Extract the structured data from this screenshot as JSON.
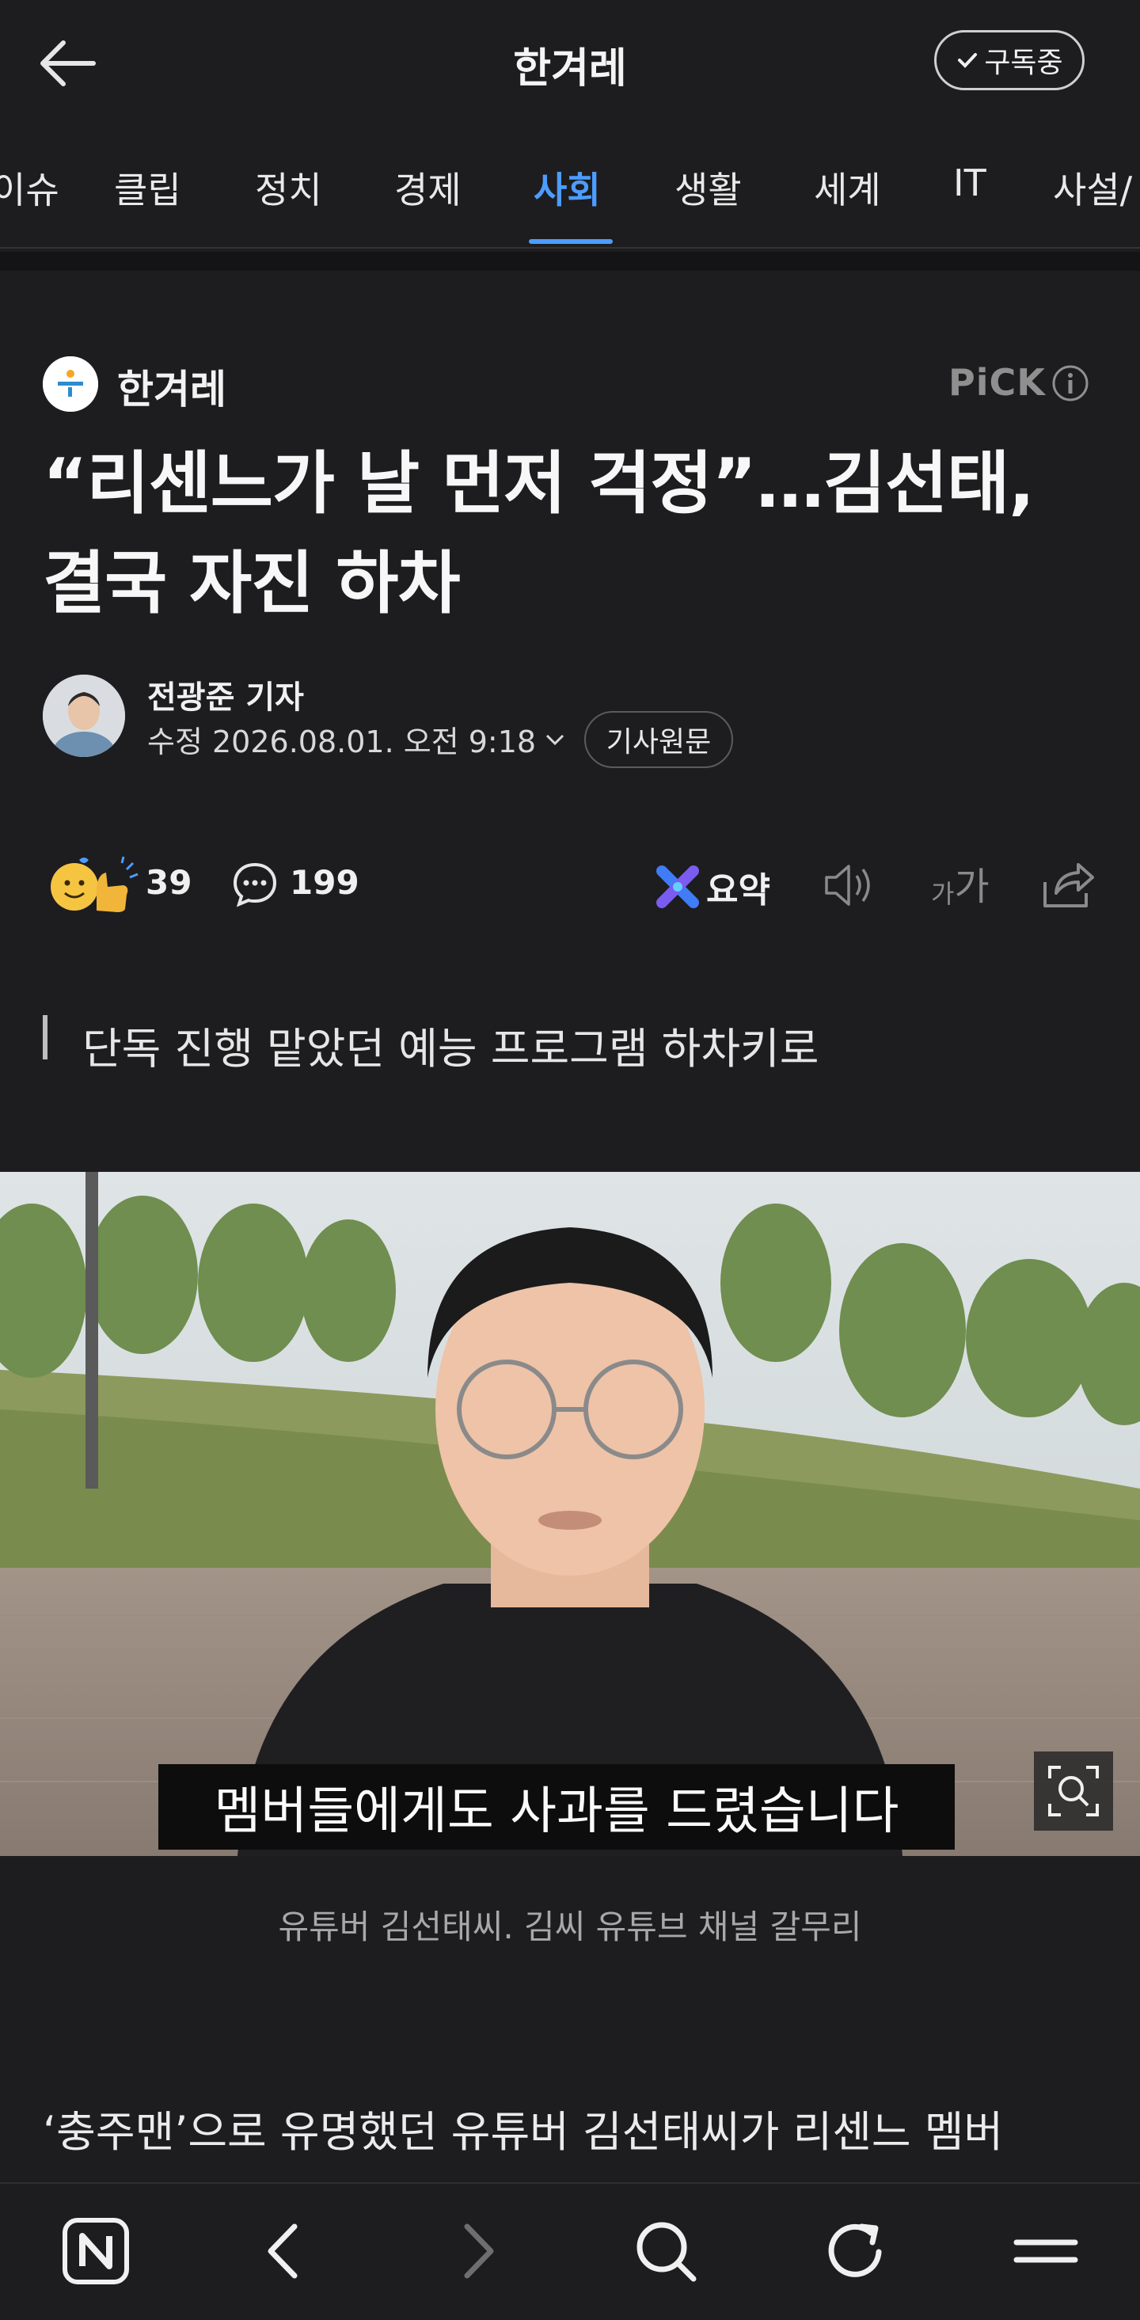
{
  "header": {
    "title": "한겨레",
    "subscribe_label": "구독중"
  },
  "tabs": [
    {
      "label": "이슈"
    },
    {
      "label": "클립"
    },
    {
      "label": "정치"
    },
    {
      "label": "경제"
    },
    {
      "label": "사회",
      "active": true
    },
    {
      "label": "생활"
    },
    {
      "label": "세계"
    },
    {
      "label": "IT"
    },
    {
      "label": "사설/"
    }
  ],
  "article": {
    "press_name": "한겨레",
    "pick_label": "PiCK",
    "headline_line1": "“리센느가 날 먼저 걱정”…김선태,",
    "headline_line2": "결국 자진 하차",
    "reporter": "전광준 기자",
    "date": "수정 2026.08.01. 오전 9:18",
    "original_label": "기사원문",
    "reaction_count": "39",
    "comment_count": "199",
    "summary_label": "요약",
    "font_label_small": "가",
    "font_label_big": "가",
    "subhead": "단독 진행 맡았던 예능 프로그램 하차키로",
    "photo_subtitle": "멤버들에게도 사과를 드렸습니다",
    "caption": "유튜버 김선태씨. 김씨 유튜브 채널 갈무리",
    "body_first_line": "‘충주맨’으로 유명했던 유튜버 김선태씨가 리센느 멤버"
  },
  "colors": {
    "background": "#1d1d1f",
    "accent": "#4d9cff"
  },
  "icons": [
    "back-arrow-icon",
    "check-icon",
    "info-icon",
    "reaction-emoji-icon",
    "comment-icon",
    "summary-icon",
    "speaker-icon",
    "font-size-icon",
    "share-icon",
    "zoom-icon",
    "home-n-icon",
    "nav-back-icon",
    "nav-forward-icon",
    "search-icon",
    "refresh-icon",
    "menu-icon"
  ]
}
